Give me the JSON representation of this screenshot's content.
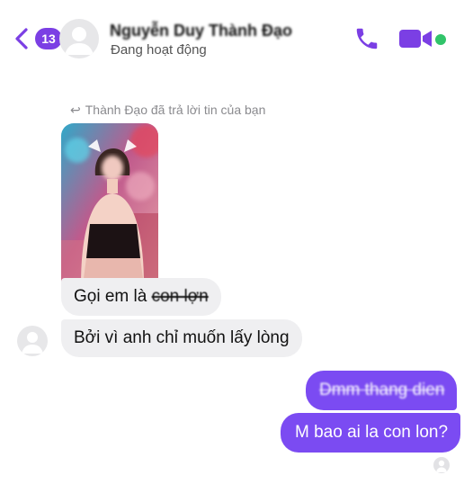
{
  "header": {
    "unread_count": "13",
    "contact_name": "Nguyễn Duy Thành Đạo",
    "status": "Đang hoạt động",
    "accent": "#7b3fe4",
    "online_color": "#31c46a",
    "icons": {
      "back": "chevron-left-icon",
      "call": "phone-icon",
      "video": "video-camera-icon"
    }
  },
  "conversation": {
    "reply_note": "Thành Đạo đã trả lời tin của bạn",
    "incoming": [
      {
        "prefix": "Gọi em là ",
        "struck": "con lợn"
      },
      {
        "text": "Bởi vì anh chỉ muốn lấy lòng"
      }
    ],
    "outgoing": [
      {
        "text": "Dmm thang dien"
      },
      {
        "text": "M bao ai la con lon?"
      }
    ],
    "bubble_colors": {
      "incoming": "#efeff1",
      "outgoing": "#7b4bf2"
    }
  }
}
